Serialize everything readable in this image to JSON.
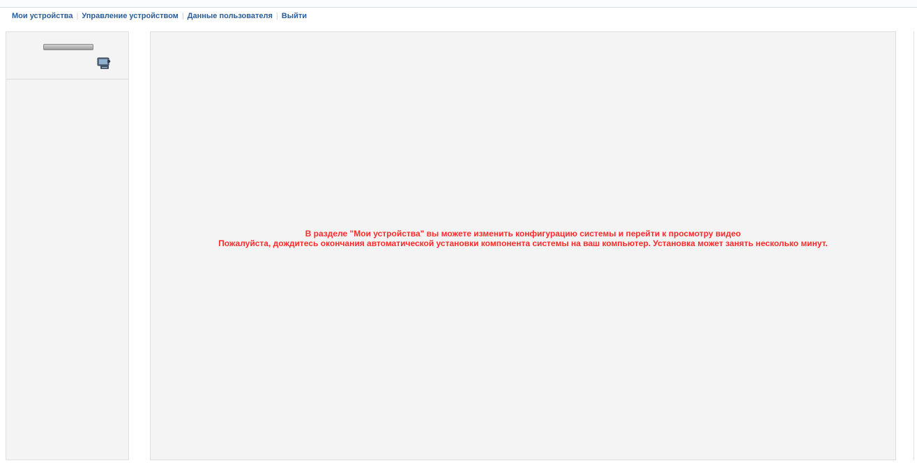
{
  "nav": {
    "items": [
      {
        "label": "Мои устройства"
      },
      {
        "label": "Управление устройством"
      },
      {
        "label": "Данные пользователя"
      },
      {
        "label": "Выйти"
      }
    ],
    "separator": "|"
  },
  "sidebar": {
    "device_label": "",
    "device_icon": "dvr-device-icon"
  },
  "main": {
    "message_line1": "В разделе \"Мои устройства\" вы можете изменить конфигурацию системы и перейти к просмотру видео",
    "message_line2": "Пожалуйста, дождитесь окончания автоматической установки компонента системы на ваш компьютер. Установка может занять несколько минут.",
    "message_color": "#ff2a2a"
  },
  "colors": {
    "nav_link": "#2b5d9b",
    "panel_bg": "#f4f4f4"
  }
}
